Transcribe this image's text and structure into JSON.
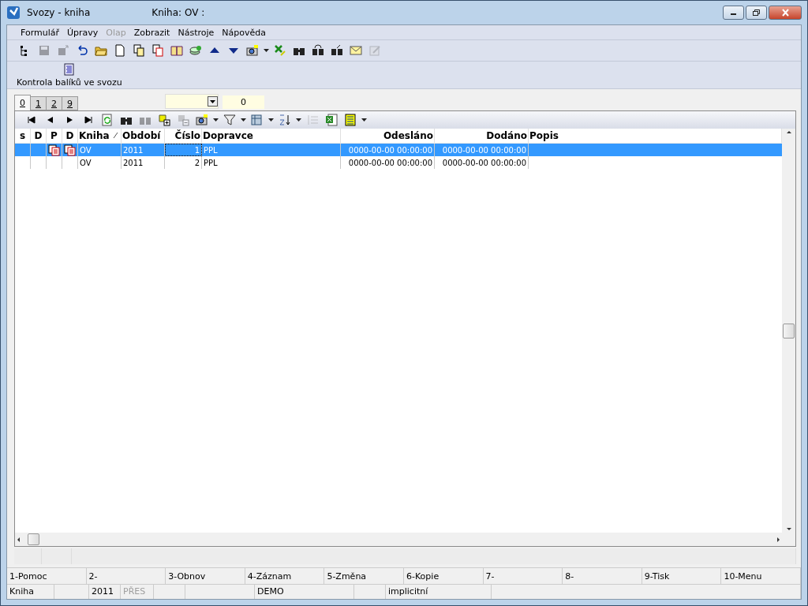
{
  "window": {
    "title": "Svozy - kniha",
    "subtitle": "Kniha: OV :"
  },
  "menu": [
    {
      "label": "Formulář",
      "disabled": false
    },
    {
      "label": "Úpravy",
      "disabled": false
    },
    {
      "label": "Olap",
      "disabled": true
    },
    {
      "label": "Zobrazit",
      "disabled": false
    },
    {
      "label": "Nástroje",
      "disabled": false
    },
    {
      "label": "Nápověda",
      "disabled": false
    }
  ],
  "toolbar": [
    {
      "disabled": false
    },
    {
      "disabled": true
    },
    {
      "disabled": true
    },
    {
      "disabled": false
    },
    {
      "disabled": false
    },
    {
      "disabled": false
    },
    {
      "disabled": false
    },
    {
      "disabled": false
    },
    {
      "disabled": false
    },
    {
      "disabled": false
    },
    {
      "disabled": false
    },
    {
      "disabled": false
    },
    {
      "disabled": false
    },
    {
      "disabled": false
    },
    {
      "disabled": false
    },
    {
      "disabled": false
    },
    {
      "disabled": false
    },
    {
      "disabled": false
    },
    {
      "disabled": true
    }
  ],
  "action_button": {
    "label": "Kontrola balíků ve svozu"
  },
  "tabs": [
    {
      "label": "0",
      "selected": true
    },
    {
      "label": "1",
      "selected": false
    },
    {
      "label": "2",
      "selected": false
    },
    {
      "label": "9",
      "selected": false
    }
  ],
  "filter": {
    "count": "0"
  },
  "grid_toolbar": [
    {
      "disabled": false
    },
    {
      "disabled": false
    },
    {
      "disabled": false
    },
    {
      "disabled": false
    },
    {
      "disabled": false
    },
    {
      "disabled": false
    },
    {
      "disabled": true
    },
    {
      "disabled": false
    },
    {
      "disabled": true
    },
    {
      "disabled": false
    },
    {
      "disabled": false
    },
    {
      "disabled": false
    },
    {
      "disabled": false
    },
    {
      "disabled": true
    },
    {
      "disabled": false
    },
    {
      "disabled": false
    }
  ],
  "table": {
    "columns": [
      "s",
      "D",
      "P",
      "D",
      "Kniha",
      "Období",
      "Číslo",
      "Dopravce",
      "Odesláno",
      "Dodáno",
      "Popis"
    ],
    "rows": [
      {
        "selected": true,
        "p_icon": true,
        "d_icon": true,
        "kniha": "OV",
        "obdobi": "2011",
        "cislo": "1",
        "dopravce": "PPL",
        "odeslano": "0000-00-00 00:00:00",
        "dodano": "0000-00-00 00:00:00"
      },
      {
        "selected": false,
        "p_icon": false,
        "d_icon": false,
        "kniha": "OV",
        "obdobi": "2011",
        "cislo": "2",
        "dopravce": "PPL",
        "odeslano": "0000-00-00 00:00:00",
        "dodano": "0000-00-00 00:00:00"
      }
    ]
  },
  "function_keys": [
    "1-Pomoc",
    "2-",
    "3-Obnov",
    "4-Záznam",
    "5-Změna",
    "6-Kopie",
    "7-",
    "8-",
    "9-Tisk",
    "10-Menu"
  ],
  "status_bar": [
    {
      "kind": "text",
      "text": "Kniha",
      "disabled": false
    },
    {
      "kind": "blank"
    },
    {
      "kind": "text",
      "text": "2011",
      "disabled": false
    },
    {
      "kind": "text",
      "text": "PŘES",
      "disabled": true
    },
    {
      "kind": "blank"
    },
    {
      "kind": "blank"
    },
    {
      "kind": "text",
      "text": "DEMO",
      "disabled": false
    },
    {
      "kind": "blank"
    },
    {
      "kind": "text",
      "text": "implicitní",
      "disabled": false
    },
    {
      "kind": "blank"
    }
  ]
}
